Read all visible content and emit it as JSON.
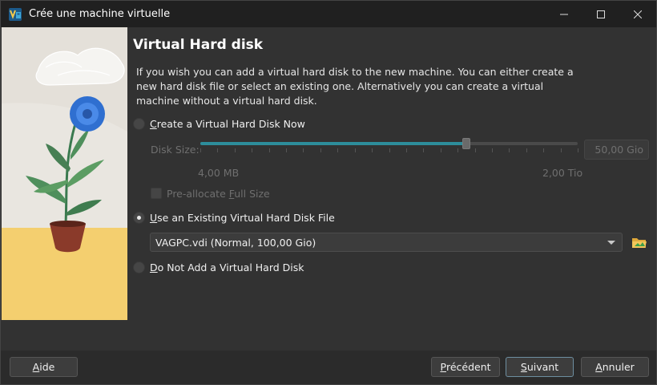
{
  "window": {
    "title": "Crée une machine virtuelle",
    "controls": {
      "minimize": "—",
      "maximize": "☐",
      "close": "✕"
    }
  },
  "page": {
    "heading": "Virtual Hard disk",
    "description": "If you wish you can add a virtual hard disk to the new machine. You can either create a new hard disk file or select an existing one. Alternatively you can create a virtual machine without a virtual hard disk."
  },
  "options": {
    "create_now": {
      "first_letter": "C",
      "rest": "reate a Virtual Hard Disk Now",
      "selected": false
    },
    "use_existing": {
      "first_letter": "U",
      "rest": "se an Existing Virtual Hard Disk File",
      "selected": true
    },
    "no_disk": {
      "first_letter": "D",
      "rest": "o Not Add a Virtual Hard Disk",
      "selected": false
    }
  },
  "disk_size": {
    "label": "Disk Size:",
    "value": "50,00 Gio",
    "min_label": "4,00 MB",
    "max_label": "2,00 Tio",
    "slider_fraction": 0.705
  },
  "preallocate": {
    "prefix": "Pre-allocate ",
    "underlined": "F",
    "suffix": "ull Size"
  },
  "existing_disk": {
    "selected": "VAGPC.vdi (Normal, 100,00 Gio)"
  },
  "footer": {
    "help": {
      "u": "A",
      "rest": "ide"
    },
    "back": {
      "u": "P",
      "rest": "récédent"
    },
    "next": {
      "u": "S",
      "rest": "uivant"
    },
    "cancel": {
      "u": "A",
      "rest": "nnuler"
    }
  },
  "icons": {
    "app": "virtualbox-icon",
    "folder": "folder-open-icon"
  },
  "colors": {
    "accent": "#2d8d9b",
    "background": "#323232"
  }
}
